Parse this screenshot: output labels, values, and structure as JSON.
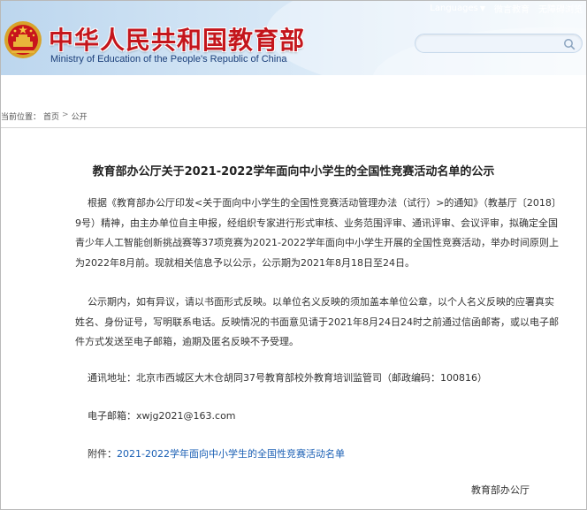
{
  "header": {
    "site_title": "中华人民共和国教育部",
    "site_subtitle": "Ministry of Education of the People's Republic of China",
    "links": {
      "languages": "Languages",
      "weibo": "微言教育",
      "accessibility": "无障碍浏览"
    },
    "search_value": "",
    "search_placeholder": ""
  },
  "breadcrumb": {
    "label": "当前位置：",
    "home": "首页",
    "separator": ">",
    "current": "公开"
  },
  "article": {
    "title": "教育部办公厅关于2021-2022学年面向中小学生的全国性竞赛活动名单的公示",
    "paragraph1": "根据《教育部办公厅印发<关于面向中小学生的全国性竞赛活动管理办法（试行）>的通知》（教基厅〔2018〕9号）精神，由主办单位自主申报，经组织专家进行形式审核、业务范围评审、通讯评审、会议评审，拟确定全国青少年人工智能创新挑战赛等37项竞赛为2021-2022学年面向中小学生开展的全国性竞赛活动，举办时间原则上为2022年8月前。现就相关信息予以公示，公示期为2021年8月18日至24日。",
    "paragraph2": "公示期内，如有异议，请以书面形式反映。以单位名义反映的须加盖本单位公章，以个人名义反映的应署真实姓名、身份证号，写明联系电话。反映情况的书面意见请于2021年8月24日24时之前通过信函邮寄，或以电子邮件方式发送至电子邮箱，逾期及匿名反映不予受理。",
    "address": "通讯地址：北京市西城区大木仓胡同37号教育部校外教育培训监管司（邮政编码：100816）",
    "email": "电子邮箱：xwjg2021@163.com",
    "attachment_label": "附件：",
    "attachment_link": "2021-2022学年面向中小学生的全国性竞赛活动名单",
    "signature": "教育部办公厅"
  },
  "colors": {
    "title_red": "#c4161c",
    "link_blue": "#1a5fb4",
    "header_blue": "#bcd6ee"
  },
  "icons": {
    "emblem": "national-emblem-icon",
    "search": "search-icon",
    "caret": "chevron-down-icon"
  }
}
